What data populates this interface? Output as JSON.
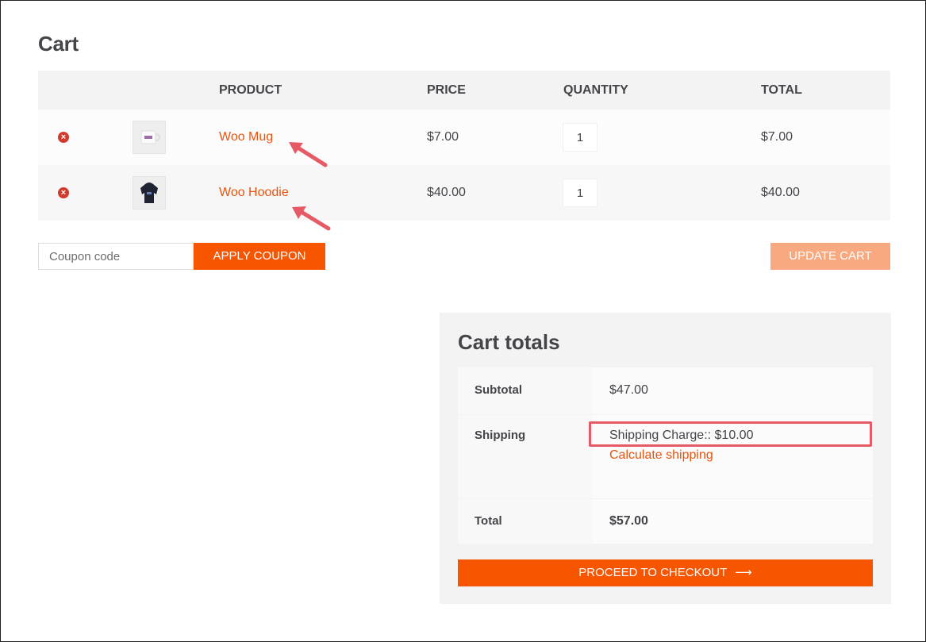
{
  "page": {
    "title": "Cart"
  },
  "table": {
    "headers": {
      "product": "PRODUCT",
      "price": "PRICE",
      "quantity": "QUANTITY",
      "total": "TOTAL"
    },
    "rows": [
      {
        "product": "Woo Mug",
        "price": "$7.00",
        "quantity": "1",
        "total": "$7.00",
        "thumb_icon": "mug-icon"
      },
      {
        "product": "Woo Hoodie",
        "price": "$40.00",
        "quantity": "1",
        "total": "$40.00",
        "thumb_icon": "hoodie-icon"
      }
    ],
    "remove_glyph": "×"
  },
  "coupon": {
    "placeholder": "Coupon code",
    "apply_label": "APPLY COUPON"
  },
  "update_label": "UPDATE CART",
  "totals": {
    "title": "Cart totals",
    "subtotal_label": "Subtotal",
    "subtotal_value": "$47.00",
    "shipping_label": "Shipping",
    "shipping_value": "Shipping Charge:: $10.00",
    "calculate_shipping": "Calculate shipping",
    "total_label": "Total",
    "total_value": "$57.00",
    "checkout_label": "PROCEED TO CHECKOUT",
    "checkout_arrow": "⟶"
  },
  "colors": {
    "accent": "#f75500",
    "link": "#e8540e",
    "annotation": "#e65a66",
    "remove": "#d13b2b"
  }
}
